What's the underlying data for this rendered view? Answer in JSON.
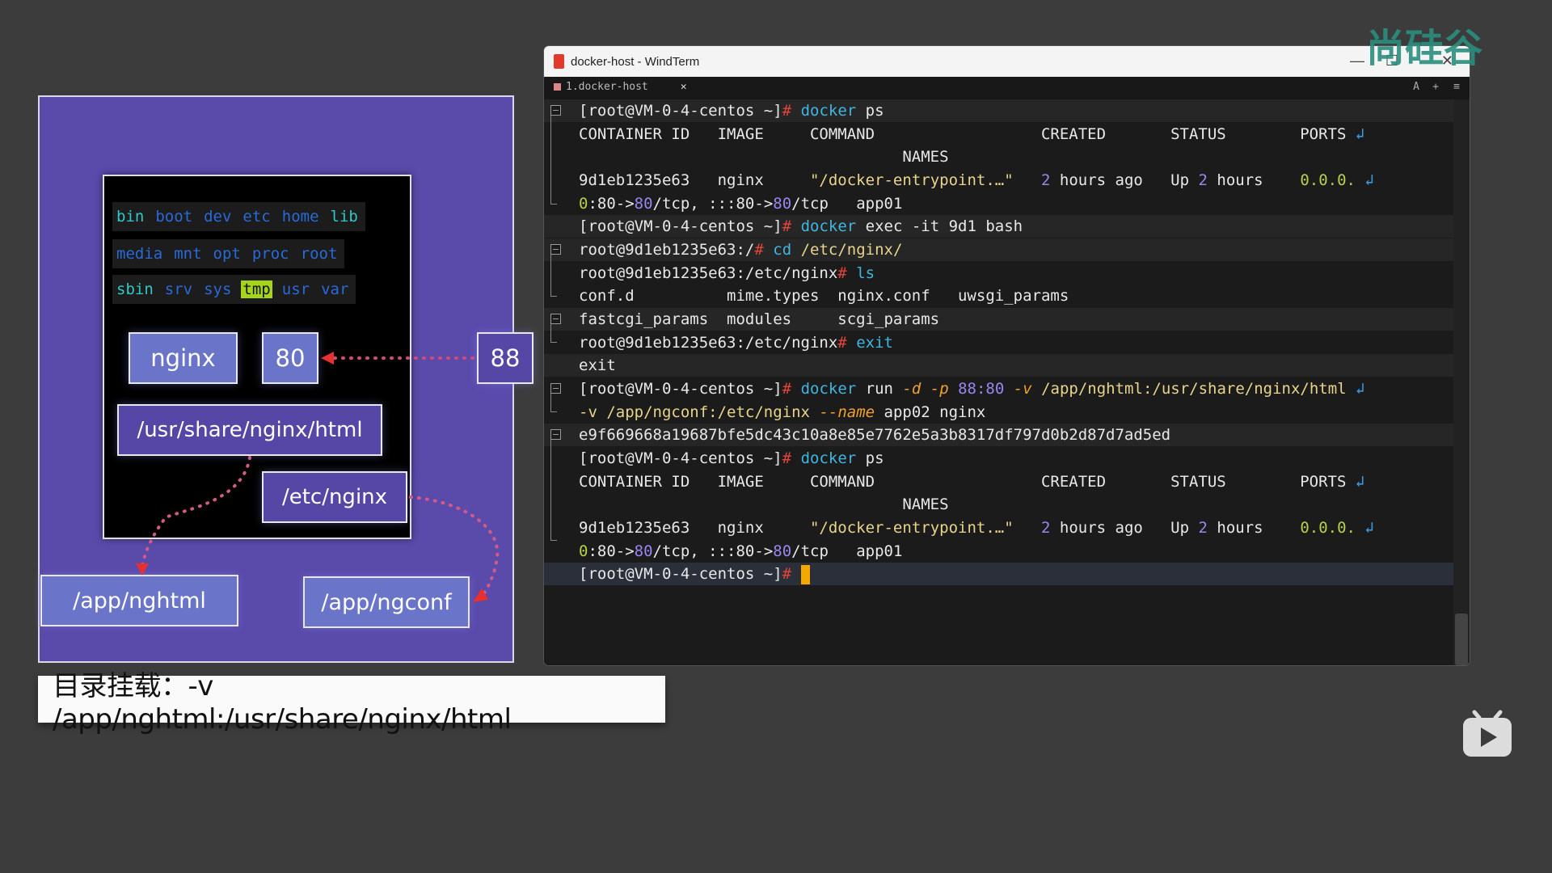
{
  "diagram": {
    "dirs_row1": [
      "bin",
      "boot",
      "dev",
      "etc",
      "home",
      "lib"
    ],
    "dirs_row2": [
      "media",
      "mnt",
      "opt",
      "proc",
      "root"
    ],
    "dirs_row3": [
      "sbin",
      "srv",
      "sys",
      "tmp",
      "usr",
      "var"
    ],
    "nginx_label": "nginx",
    "container_port": "80",
    "host_port": "88",
    "container_html_path": "/usr/share/nginx/html",
    "container_conf_path": "/etc/nginx",
    "host_html_path": "/app/nghtml",
    "host_conf_path": "/app/ngconf"
  },
  "caption": "目录挂载：-v /app/nghtml:/usr/share/nginx/html",
  "window": {
    "title": "docker-host - WindTerm",
    "tab_label": "1.docker-host",
    "tab_close": "✕",
    "tools": [
      "A",
      "+",
      "≡"
    ],
    "controls": {
      "minimize": "—",
      "maximize": "☐",
      "close": "✕"
    }
  },
  "terminal": {
    "prompt_host": "[root@VM-0-4-centos ~]",
    "prompt_container_root": "root@9d1eb1235e63:/",
    "prompt_container_nginx": "root@9d1eb1235e63:/etc/nginx",
    "hash": "#",
    "cmd_docker": "docker",
    "cmd_ps": " ps",
    "header_line": "CONTAINER ID   IMAGE     COMMAND                  CREATED       STATUS        PORTS",
    "header_names": "                                   NAMES",
    "row_id_image": "9d1eb1235e63   nginx     ",
    "row_command": "\"/docker-entrypoint.…\"",
    "row_created_num": "2",
    "row_created_rest": " hours ago",
    "row_status_up": "Up ",
    "row_status_num": "2",
    "row_status_rest": " hours",
    "row_ports_start": "0.0.0.",
    "ports_cont_0": "0",
    "ports_cont_a": ":80->",
    "ports_cont_80": "80",
    "ports_cont_b": "/tcp, :::80->",
    "ports_cont_c": "/tcp   app01",
    "exec_cmd": " exec -it 9d1 bash",
    "cd_cmd": "cd",
    "cd_path": " /etc/nginx/",
    "ls_cmd": "ls",
    "ls_row1": "conf.d          mime.types  nginx.conf   uwsgi_params",
    "ls_row2": "fastcgi_params  modules     scgi_params",
    "exit_cmd": "exit",
    "exit_out": "exit",
    "run_cmd": " run ",
    "run_d": "-d",
    "run_p": "-p",
    "run_port": "88:80",
    "run_v": "-v",
    "run_vol1": "/app/nghtml:/usr/share/nginx/html",
    "run_v2": "-v /app/ngconf:/etc/nginx",
    "run_name_flag": "--name",
    "run_tail": " app02 nginx",
    "run_output": "e9f669668a19687bfe5dc43c10a8e85e7762e5a3b8317df797d0b2d87d7ad5ed",
    "wrap_marker": "↲"
  },
  "watermark": "尚硅谷"
}
